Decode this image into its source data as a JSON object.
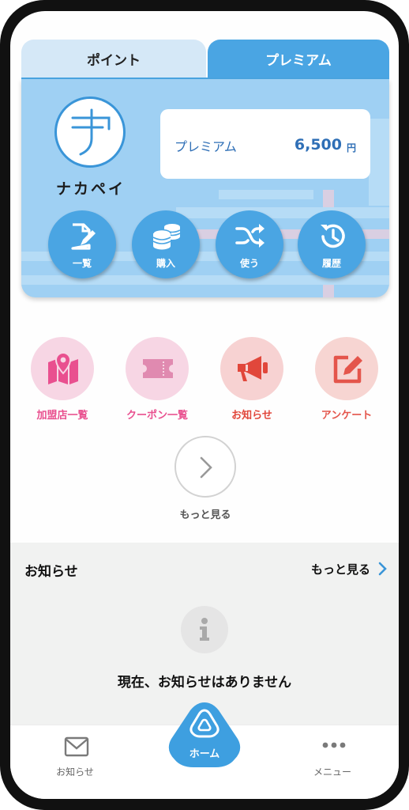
{
  "colors": {
    "accent": "#4aa5e3",
    "card_bg": "#9fd0f3",
    "balance_text": "#2f6fb6",
    "pink": "#e9508f",
    "red": "#e1473b",
    "orange_red": "#e4554b"
  },
  "tabs": [
    {
      "label": "ポイント",
      "active": false
    },
    {
      "label": "プレミアム",
      "active": true
    }
  ],
  "card": {
    "logo_text": "ナカペイ",
    "balance_label": "プレミアム",
    "balance_value": "6,500",
    "balance_unit": "円",
    "actions": [
      {
        "label": "一覧",
        "icon": "document-edit-icon"
      },
      {
        "label": "購入",
        "icon": "coins-icon"
      },
      {
        "label": "使う",
        "icon": "shuffle-icon"
      },
      {
        "label": "履歴",
        "icon": "history-icon"
      }
    ]
  },
  "menu": [
    {
      "label": "加盟店一覧",
      "icon": "map-pin-icon"
    },
    {
      "label": "クーポン一覧",
      "icon": "ticket-icon"
    },
    {
      "label": "お知らせ",
      "icon": "megaphone-icon"
    },
    {
      "label": "アンケート",
      "icon": "edit-square-icon"
    }
  ],
  "more_label": "もっと見る",
  "notice": {
    "title": "お知らせ",
    "more_label": "もっと見る",
    "empty_message": "現在、お知らせはありません"
  },
  "bottom_nav": {
    "left": "お知らせ",
    "center": "ホーム",
    "right": "メニュー"
  }
}
